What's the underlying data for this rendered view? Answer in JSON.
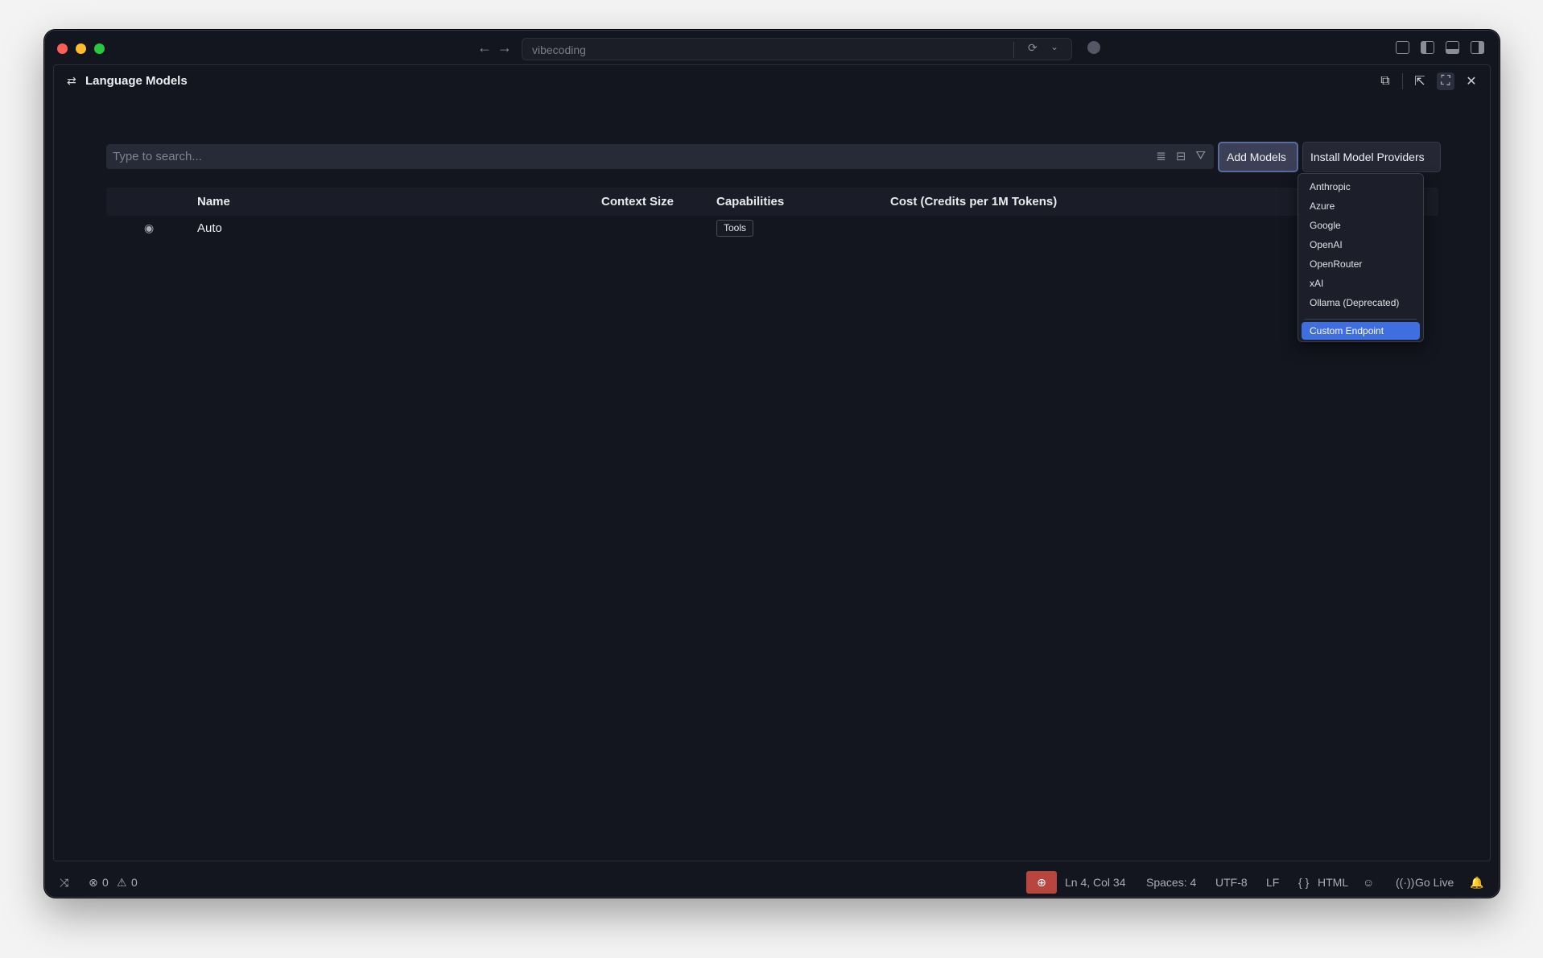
{
  "window": {
    "address_text": "vibecoding",
    "icons": [
      "back-arrow-icon",
      "forward-arrow-icon",
      "sync-icon",
      "chevron-down-icon",
      "copilot-icon",
      "customize-layout-icon",
      "toggle-primary-sidebar-icon",
      "toggle-panel-icon",
      "toggle-secondary-sidebar-icon"
    ]
  },
  "panel": {
    "title": "Language Models",
    "title_icon": "settings-sliders-icon",
    "actions": [
      "copy-icon",
      "open-in-editor-icon",
      "maximize-icon",
      "close-icon"
    ]
  },
  "search": {
    "placeholder": "Type to search...",
    "value": ""
  },
  "buttons": {
    "add_models": "Add Models",
    "install_providers": "Install Model Providers"
  },
  "table": {
    "columns": [
      "Name",
      "Context Size",
      "Capabilities",
      "Cost (Credits per 1M Tokens)"
    ],
    "rows": [
      {
        "name": "Auto",
        "context_size": "",
        "capabilities": [
          "Tools"
        ],
        "cost": ""
      }
    ]
  },
  "dropdown": {
    "items": [
      "Anthropic",
      "Azure",
      "Google",
      "OpenAI",
      "OpenRouter",
      "xAI",
      "Ollama (Deprecated)"
    ],
    "selected": "Custom Endpoint"
  },
  "statusbar": {
    "errors": "0",
    "warnings": "0",
    "position": "Ln 4, Col 34",
    "spaces": "Spaces: 4",
    "encoding": "UTF-8",
    "eol": "LF",
    "language": "HTML",
    "go_live": "Go Live"
  },
  "colors": {
    "background": "#13151f",
    "accent": "#3f6ee0",
    "zoom_badge": "#b8463e"
  }
}
